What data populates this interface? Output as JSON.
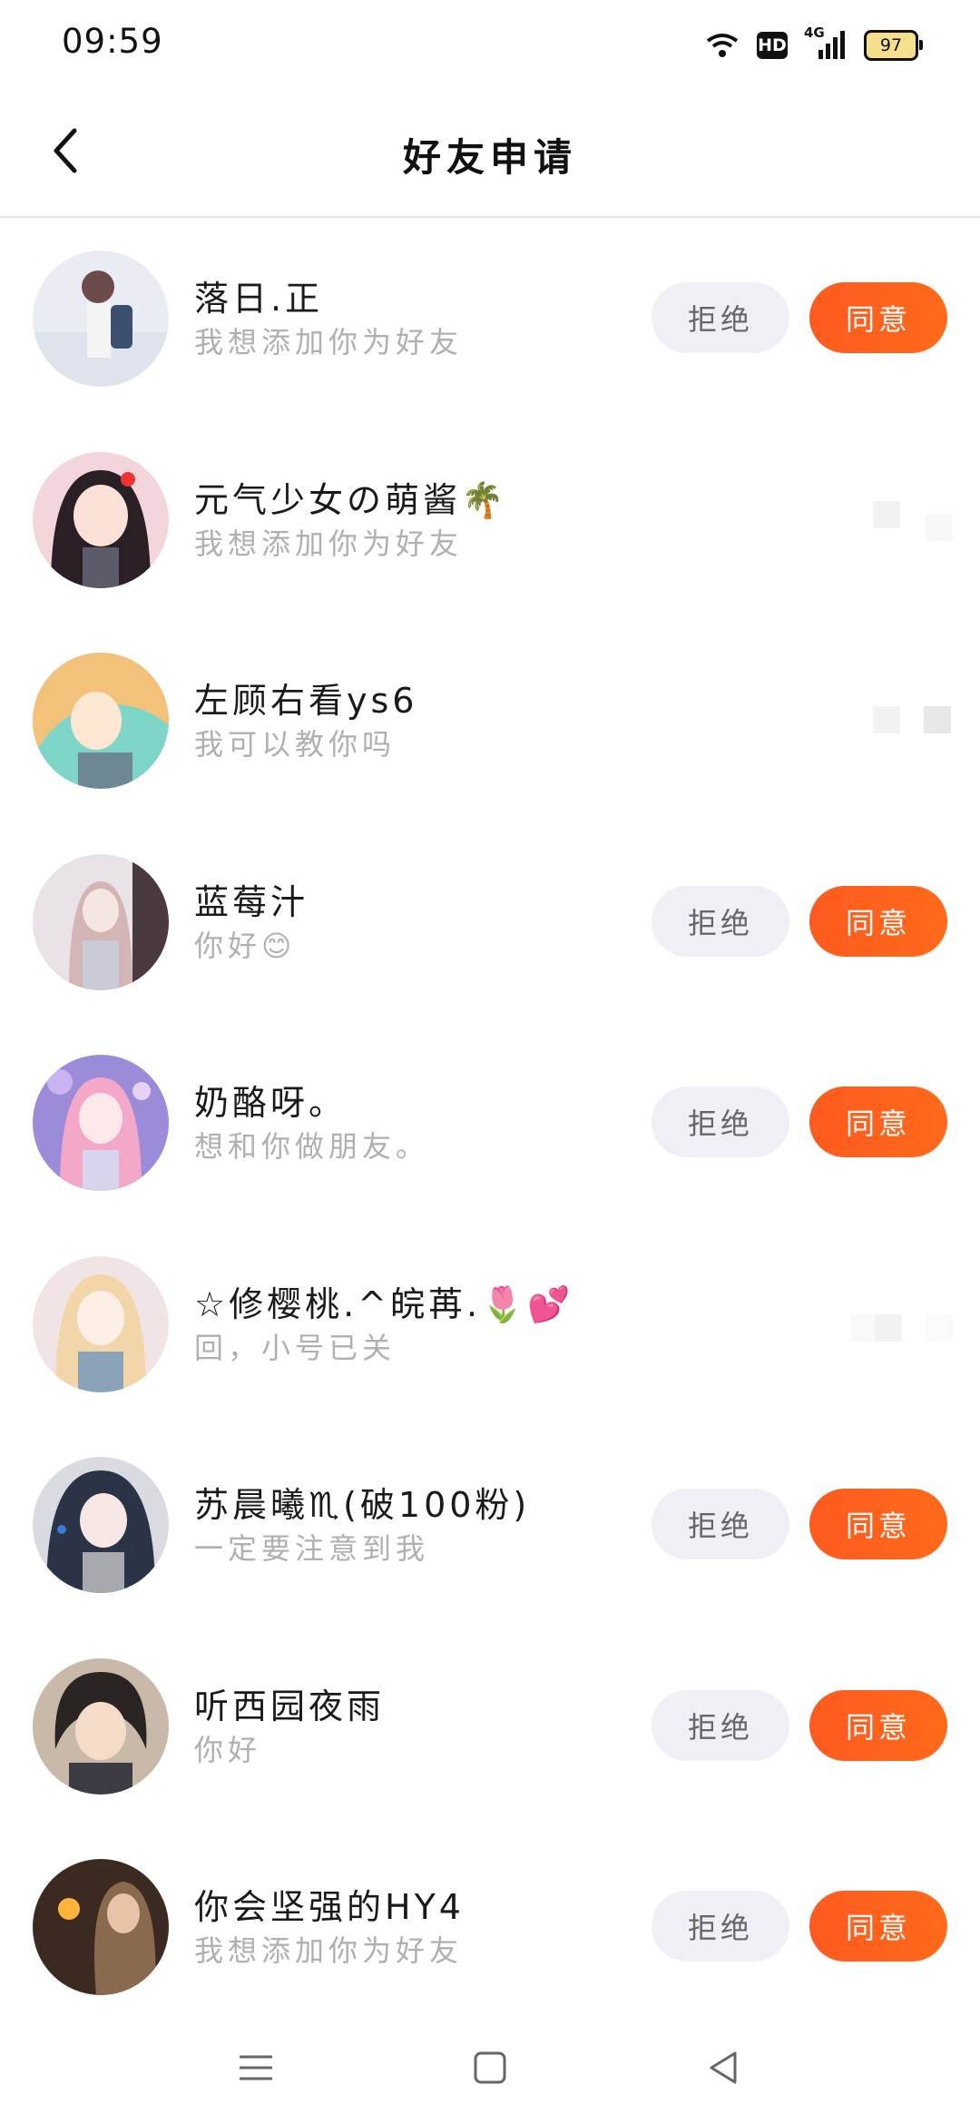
{
  "status": {
    "time": "09:59",
    "hd": "HD",
    "network": "4G",
    "battery": "97"
  },
  "header": {
    "title": "好友申请"
  },
  "actions": {
    "reject": "拒绝",
    "agree": "同意"
  },
  "requests": [
    {
      "name": "落日.正",
      "message": "我想添加你为好友"
    },
    {
      "name": "元气少女の萌酱🌴",
      "message": "我想添加你为好友"
    },
    {
      "name": "左顾右看ys6",
      "message": "我可以教你吗"
    },
    {
      "name": "蓝莓汁",
      "message": "你好😊"
    },
    {
      "name": "奶酪呀。",
      "message": "想和你做朋友。"
    },
    {
      "name": "☆修樱桃.^皖苒.🌷💕",
      "message": "回，小号已关"
    },
    {
      "name": "苏晨曦♏(破100粉)",
      "message": "一定要注意到我"
    },
    {
      "name": "听西园夜雨",
      "message": "你好"
    },
    {
      "name": "你会坚强的HY4",
      "message": "我想添加你为好友"
    }
  ],
  "colors": {
    "accent": "#ff5a1f",
    "reject_bg": "#eef0f5",
    "muted_text": "#b0b0b0"
  },
  "icons": {
    "back": "chevron-left-icon",
    "menu": "menu-icon",
    "home": "home-square-icon",
    "nav_back": "triangle-back-icon"
  }
}
